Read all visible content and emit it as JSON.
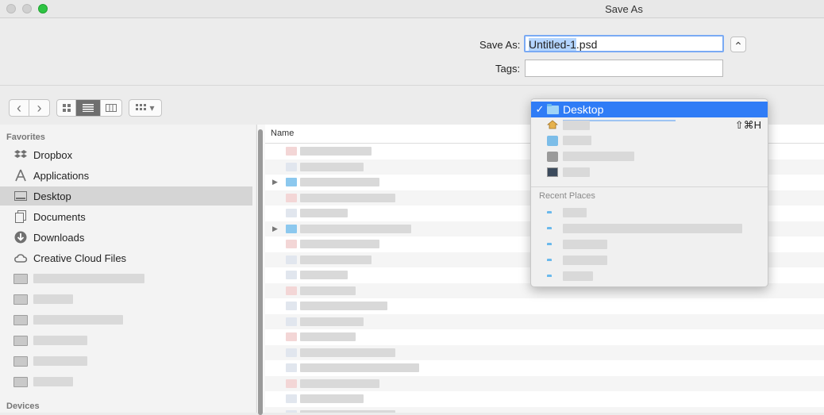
{
  "window": {
    "title": "Save As"
  },
  "save": {
    "save_as_label": "Save As:",
    "filename_selected": "Untitled-1",
    "filename_rest": ".psd",
    "tags_label": "Tags:",
    "tags_value": "",
    "expand_glyph": "⌃"
  },
  "toolbar": {
    "back_glyph": "‹",
    "forward_glyph": "›",
    "view_options": [
      "icon-view",
      "list-view",
      "column-view"
    ],
    "selected_view": "list-view",
    "arrange_glyph": "▾"
  },
  "sidebar": {
    "favorites_label": "Favorites",
    "items": [
      {
        "label": "Dropbox",
        "icon": "dropbox-icon"
      },
      {
        "label": "Applications",
        "icon": "applications-icon"
      },
      {
        "label": "Desktop",
        "icon": "desktop-icon",
        "selected": true
      },
      {
        "label": "Documents",
        "icon": "documents-icon"
      },
      {
        "label": "Downloads",
        "icon": "downloads-icon"
      },
      {
        "label": "Creative Cloud Files",
        "icon": "creative-cloud-icon"
      }
    ],
    "devices_label": "Devices"
  },
  "filelist": {
    "column_name": "Name"
  },
  "location_popup": {
    "selected": "Desktop",
    "check_glyph": "✓",
    "home_shortcut": "⇧⌘H",
    "recent_places_label": "Recent Places"
  },
  "colors": {
    "accent": "#2f7cf6",
    "folder": "#6ab9ec",
    "selection_text": "#b4d5fe"
  }
}
